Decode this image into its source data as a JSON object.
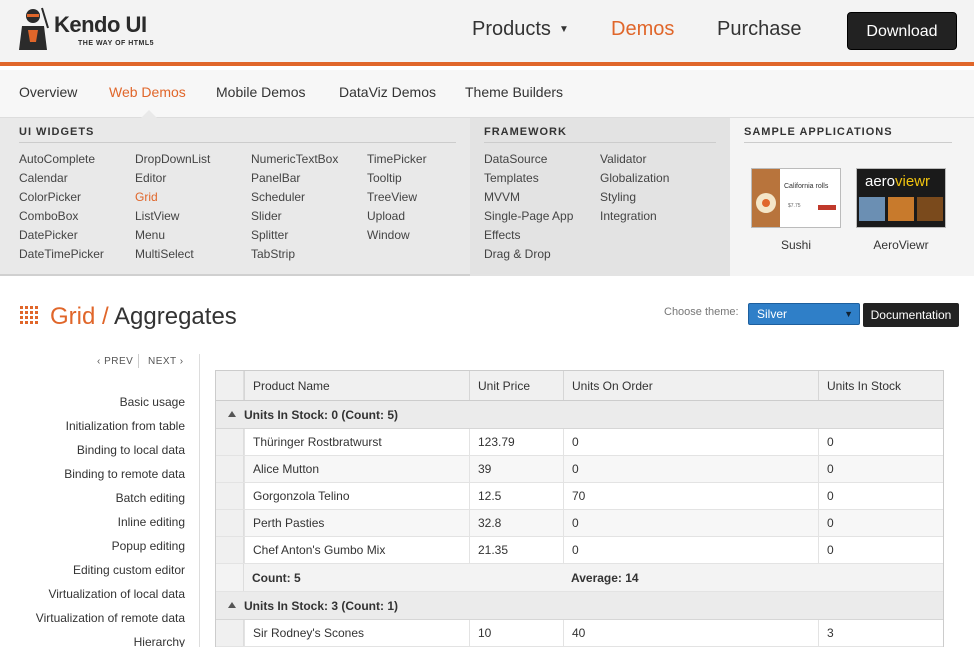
{
  "header": {
    "logo_title": "Kendo UI",
    "logo_tagline": "THE WAY OF HTML5",
    "nav": [
      {
        "label": "Products",
        "caret": "▼"
      },
      {
        "label": "Demos"
      },
      {
        "label": "Purchase"
      }
    ],
    "download_label": "Download"
  },
  "subnav": {
    "items": [
      "Overview",
      "Web Demos",
      "Mobile Demos",
      "DataViz Demos",
      "Theme Builders"
    ],
    "active": "Web Demos"
  },
  "mega": {
    "widgets_head": "UI WIDGETS",
    "widgets": [
      [
        "AutoComplete",
        "Calendar",
        "ColorPicker",
        "ComboBox",
        "DatePicker",
        "DateTimePicker"
      ],
      [
        "DropDownList",
        "Editor",
        "Grid",
        "ListView",
        "Menu",
        "MultiSelect"
      ],
      [
        "NumericTextBox",
        "PanelBar",
        "Scheduler",
        "Slider",
        "Splitter",
        "TabStrip"
      ],
      [
        "TimePicker",
        "Tooltip",
        "TreeView",
        "Upload",
        "Window"
      ]
    ],
    "framework_head": "FRAMEWORK",
    "framework": [
      [
        "DataSource",
        "Templates",
        "MVVM",
        "Single-Page App",
        "Effects",
        "Drag & Drop"
      ],
      [
        "Validator",
        "Globalization",
        "Styling",
        "Integration"
      ]
    ],
    "samples_head": "SAMPLE APPLICATIONS",
    "samples": [
      {
        "label": "Sushi",
        "thumb_text": "California rolls",
        "thumb_price": "$7.75"
      },
      {
        "label": "AeroViewr",
        "thumb_text_a": "aero",
        "thumb_text_b": "viewr"
      }
    ]
  },
  "page": {
    "title_crumb": "Grid",
    "title_sep": " / ",
    "title_main": "Aggregates",
    "theme_label": "Choose theme:",
    "theme_value": "Silver",
    "theme_arrow": "▼",
    "doc_button": "Documentation"
  },
  "sidenav": {
    "prev": "‹ PREV",
    "next": "NEXT ›",
    "links": [
      "Basic usage",
      "Initialization from table",
      "Binding to local data",
      "Binding to remote data",
      "Batch editing",
      "Inline editing",
      "Popup editing",
      "Editing custom editor",
      "Virtualization of local data",
      "Virtualization of remote data",
      "Hierarchy"
    ]
  },
  "grid": {
    "columns": [
      "Product Name",
      "Unit Price",
      "Units On Order",
      "Units In Stock"
    ],
    "groups": [
      {
        "label": "Units In Stock: 0 (Count: 5)",
        "rows": [
          [
            "Thüringer Rostbratwurst",
            "123.79",
            "0",
            "0"
          ],
          [
            "Alice Mutton",
            "39",
            "0",
            "0"
          ],
          [
            "Gorgonzola Telino",
            "12.5",
            "70",
            "0"
          ],
          [
            "Perth Pasties",
            "32.8",
            "0",
            "0"
          ],
          [
            "Chef Anton's Gumbo Mix",
            "21.35",
            "0",
            "0"
          ]
        ],
        "footer_count": "Count: 5",
        "footer_avg": "Average: 14"
      },
      {
        "label": "Units In Stock: 3 (Count: 1)",
        "rows": [
          [
            "Sir Rodney's Scones",
            "10",
            "40",
            "3"
          ]
        ]
      }
    ]
  },
  "colors": {
    "accent": "#e0662a",
    "theme_select": "#2f7fc8",
    "dark_button": "#222222"
  }
}
